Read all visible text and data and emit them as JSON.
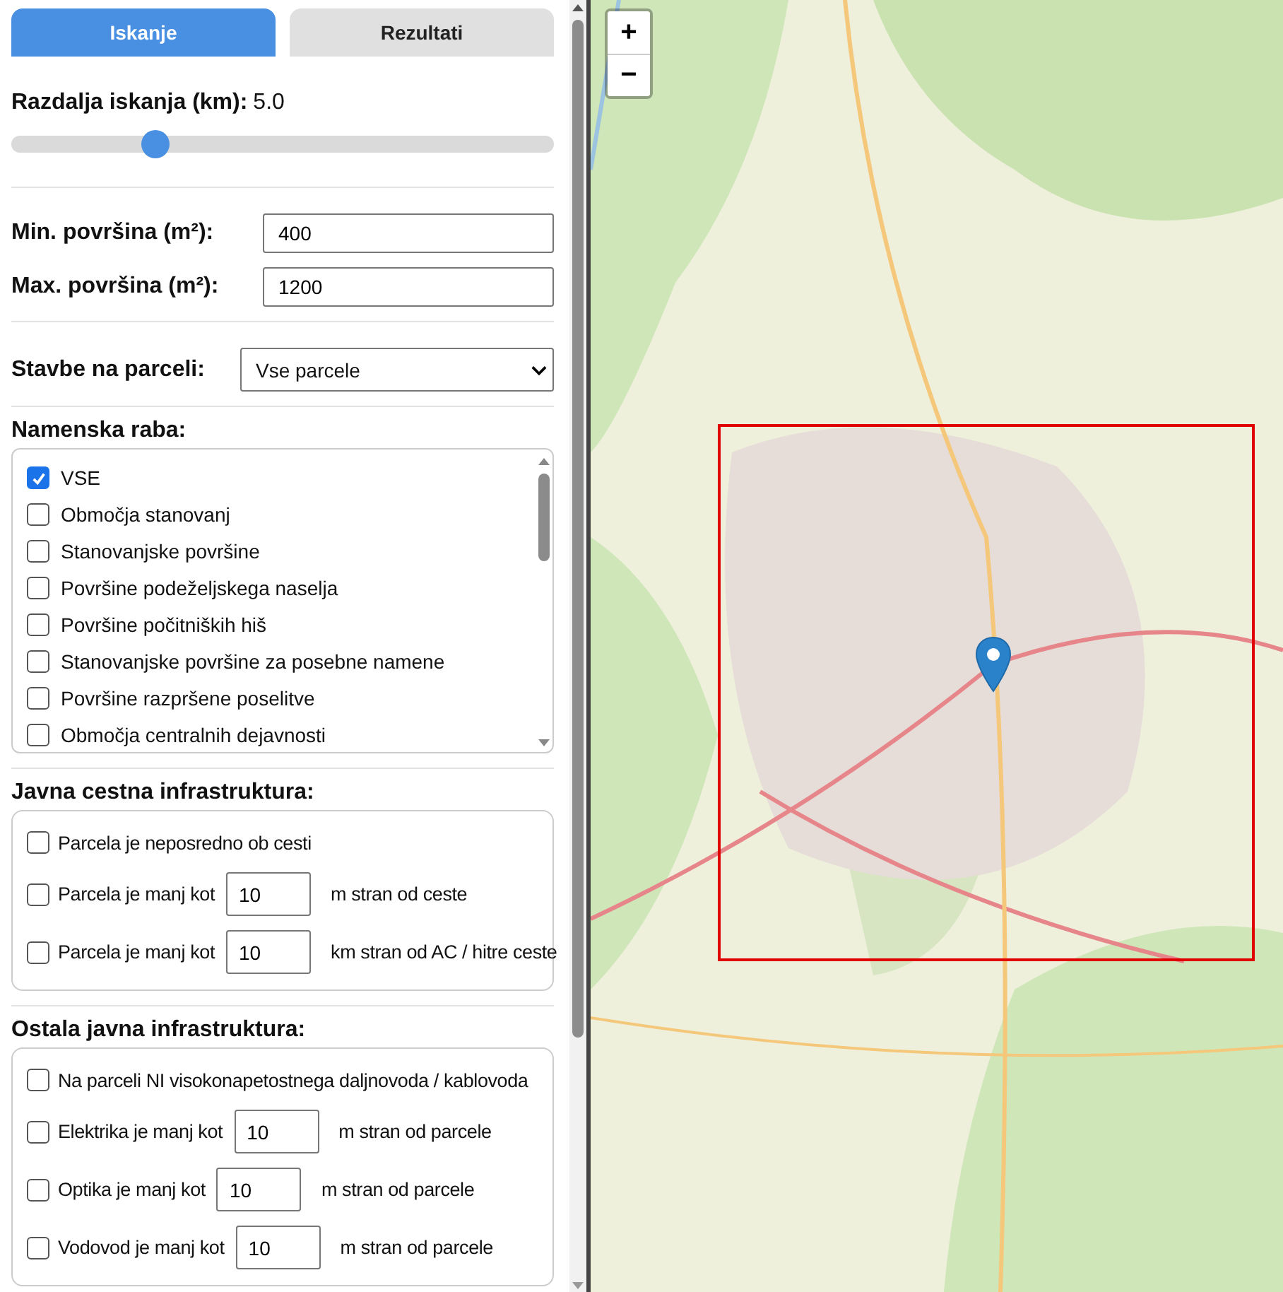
{
  "tabs": [
    {
      "label": "Iskanje",
      "selected": true
    },
    {
      "label": "Rezultati",
      "selected": false
    }
  ],
  "distance": {
    "label": "Razdalja iskanja (km):",
    "value": "5.0",
    "level": 0.265
  },
  "area": [
    {
      "label": "Min. površina (m²):",
      "value": "400"
    },
    {
      "label": "Max. površina (m²):",
      "value": "1200"
    }
  ],
  "buildings": {
    "label": "Stavbe na parceli:",
    "value": "Vse parcele"
  },
  "land_use": {
    "title": "Namenska raba:",
    "items": [
      {
        "label": "VSE",
        "checked": true
      },
      {
        "label": "Območja stanovanj",
        "checked": false
      },
      {
        "label": "Stanovanjske površine",
        "checked": false
      },
      {
        "label": "Površine podeželjskega naselja",
        "checked": false
      },
      {
        "label": "Površine počitniških hiš",
        "checked": false
      },
      {
        "label": "Stanovanjske površine za posebne namene",
        "checked": false
      },
      {
        "label": "Površine razpršene poselitve",
        "checked": false
      },
      {
        "label": "Območja centralnih dejavnosti",
        "checked": false
      }
    ]
  },
  "sections": [
    {
      "title": "Javna cestna infrastruktura:",
      "options": [
        {
          "kind": "check",
          "label": "Parcela je neposredno ob cesti",
          "checked": false
        },
        {
          "kind": "distance",
          "label": "Parcela je manj kot",
          "value": "10",
          "suffix": "m stran od ceste",
          "checked": false
        },
        {
          "kind": "distance",
          "label": "Parcela je manj kot",
          "value": "10",
          "suffix": "km stran od AC / hitre ceste",
          "checked": false
        }
      ]
    },
    {
      "title": "Ostala javna infrastruktura:",
      "options": [
        {
          "kind": "check",
          "label": "Na parceli NI visokonapetostnega daljnovoda / kablovoda",
          "checked": false
        },
        {
          "kind": "distance",
          "label": "Elektrika je manj kot",
          "value": "10",
          "suffix": "m stran od parcele",
          "checked": false
        },
        {
          "kind": "distance",
          "label": "Optika je manj kot",
          "value": "10",
          "suffix": "m stran od parcele",
          "checked": false
        },
        {
          "kind": "distance",
          "label": "Vodovod je manj kot",
          "value": "10",
          "suffix": "m stran od parcele",
          "checked": false
        }
      ]
    }
  ],
  "map": {
    "zoom_in": "+",
    "zoom_out": "−"
  }
}
